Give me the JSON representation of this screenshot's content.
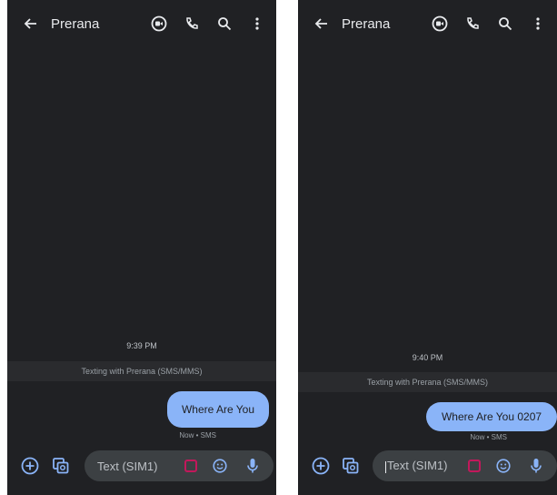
{
  "screens": [
    {
      "contact_name": "Prerana",
      "timestamp": "9:39 PM",
      "texting_notice": "Texting with Prerana (SMS/MMS)",
      "message_text": "Where Are You",
      "message_status": "Now • SMS",
      "compose_placeholder": "Text (SIM1)"
    },
    {
      "contact_name": "Prerana",
      "timestamp": "9:40 PM",
      "texting_notice": "Texting with Prerana (SMS/MMS)",
      "message_text": "Where Are You 0207",
      "message_status": "Now • SMS",
      "compose_placeholder": "Text (SIM1)"
    }
  ],
  "colors": {
    "background": "#202124",
    "bubble": "#8ab4f8",
    "icon": "#e8eaed",
    "accent_icon": "#8ab4f8",
    "sticker_icon": "#c2185b"
  },
  "icons": {
    "top_bar": [
      "back-arrow-icon",
      "video-call-icon",
      "phone-icon",
      "search-icon",
      "more-vert-icon"
    ],
    "compose": [
      "add-icon",
      "gallery-icon",
      "sticker-icon",
      "emoji-icon",
      "mic-icon"
    ]
  }
}
